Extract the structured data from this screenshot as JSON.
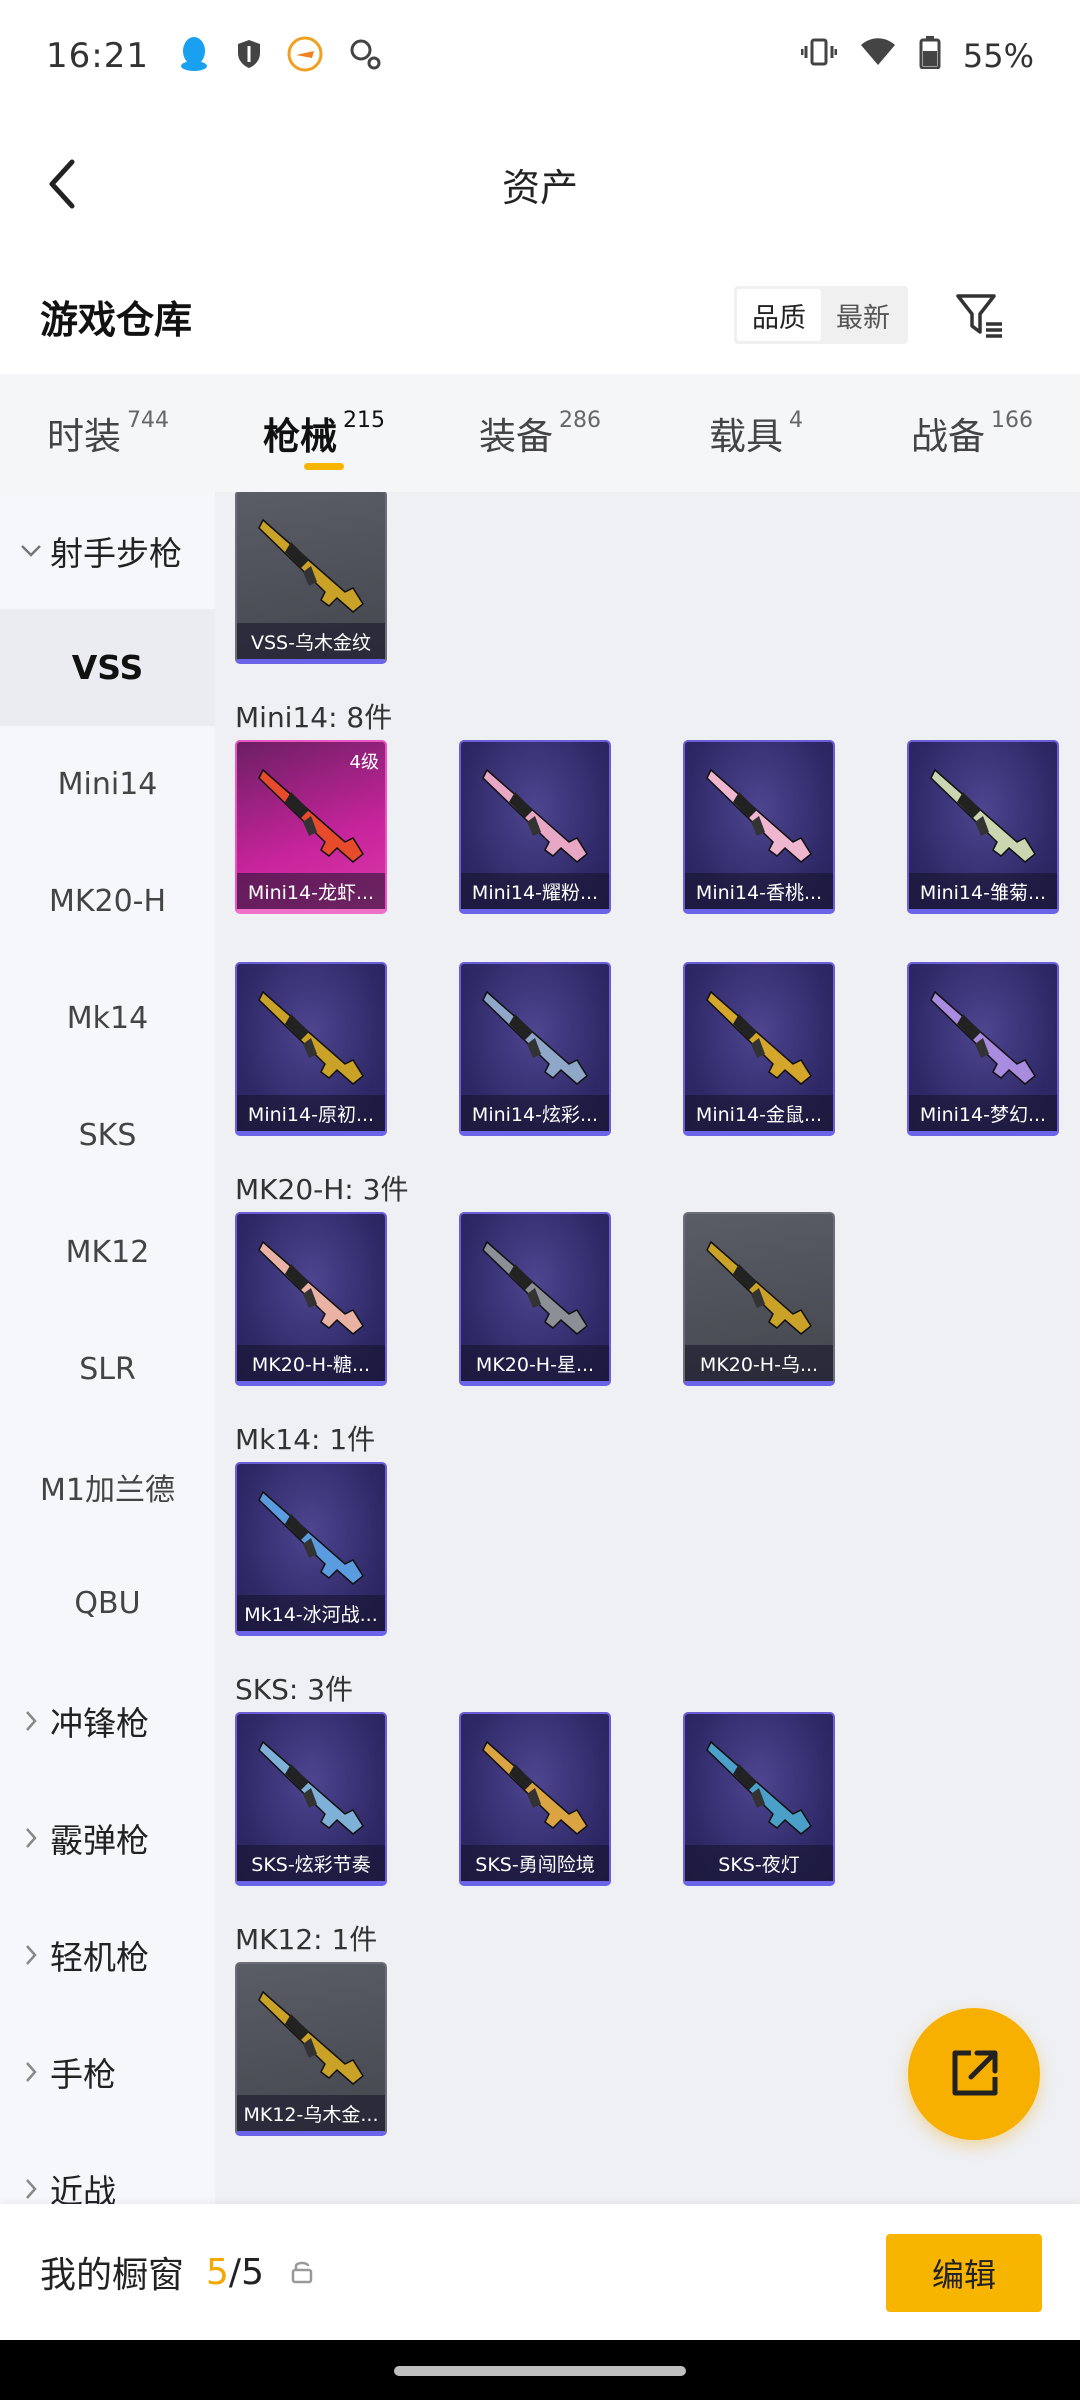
{
  "status_bar": {
    "time": "16:21",
    "battery": "55%",
    "left_icons": [
      "qq-icon",
      "shield-icon",
      "game-app-icon",
      "search-key-icon"
    ],
    "right_icons": [
      "vibrate-icon",
      "wifi-icon",
      "battery-icon"
    ]
  },
  "header": {
    "title": "资产"
  },
  "section": {
    "title": "游戏仓库",
    "sort_options": [
      "品质",
      "最新"
    ],
    "sort_active": "品质"
  },
  "tabs": [
    {
      "label": "时装",
      "count": "744"
    },
    {
      "label": "枪械",
      "count": "215"
    },
    {
      "label": "装备",
      "count": "286"
    },
    {
      "label": "载具",
      "count": "4"
    },
    {
      "label": "战备",
      "count": "166"
    }
  ],
  "active_tab": "枪械",
  "sidebar": {
    "expanded_category": "射手步枪",
    "sub_items": [
      "VSS",
      "Mini14",
      "MK20-H",
      "Mk14",
      "SKS",
      "MK12",
      "SLR",
      "M1加兰德",
      "QBU"
    ],
    "active_sub": "VSS",
    "collapsed_categories": [
      "冲锋枪",
      "霰弹枪",
      "轻机枪",
      "手枪",
      "近战"
    ]
  },
  "groups": [
    {
      "title": "",
      "cards": [
        {
          "label": "VSS-乌木金纹",
          "style": "gray",
          "gun_color": "#c9a227"
        }
      ]
    },
    {
      "title": "Mini14: 8件",
      "cards": [
        {
          "label": "Mini14-龙虾...",
          "style": "pink",
          "badge": "4级",
          "gun_color": "#e84a2c"
        },
        {
          "label": "Mini14-耀粉...",
          "style": "purple",
          "gun_color": "#e8a7c4"
        },
        {
          "label": "Mini14-香桃...",
          "style": "purple",
          "gun_color": "#f0b6cf"
        },
        {
          "label": "Mini14-雏菊...",
          "style": "purple",
          "gun_color": "#c9d6b0"
        },
        {
          "label": "Mini14-原初...",
          "style": "purple",
          "gun_color": "#c9a227"
        },
        {
          "label": "Mini14-炫彩...",
          "style": "purple",
          "gun_color": "#8fa7c9"
        },
        {
          "label": "Mini14-金鼠...",
          "style": "purple",
          "gun_color": "#d4a72c"
        },
        {
          "label": "Mini14-梦幻...",
          "style": "purple",
          "gun_color": "#a98be0"
        }
      ]
    },
    {
      "title": "MK20-H: 3件",
      "cards": [
        {
          "label": "MK20-H-糖...",
          "style": "purple",
          "gun_color": "#e9b2a5"
        },
        {
          "label": "MK20-H-星...",
          "style": "purple",
          "gun_color": "#8c8f96"
        },
        {
          "label": "MK20-H-乌...",
          "style": "gray",
          "gun_color": "#c9a227"
        }
      ]
    },
    {
      "title": "Mk14: 1件",
      "cards": [
        {
          "label": "Mk14-冰河战...",
          "style": "purple",
          "gun_color": "#5b9be0"
        }
      ]
    },
    {
      "title": "SKS: 3件",
      "cards": [
        {
          "label": "SKS-炫彩节奏",
          "style": "purple",
          "gun_color": "#7fb0d8"
        },
        {
          "label": "SKS-勇闯险境",
          "style": "purple",
          "gun_color": "#d9a441"
        },
        {
          "label": "SKS-夜灯",
          "style": "purple",
          "gun_color": "#4aa0c8"
        }
      ]
    },
    {
      "title": "MK12: 1件",
      "cards": [
        {
          "label": "MK12-乌木金...",
          "style": "gray",
          "gun_color": "#c9a227"
        }
      ]
    }
  ],
  "bottom_bar": {
    "label": "我的橱窗",
    "current": "5",
    "separator": "/",
    "total": "5",
    "edit_label": "编辑"
  },
  "colors": {
    "accent": "#f8b500",
    "card_purple": "#2e2866",
    "card_pink": "#c8249c",
    "card_border": "#6b63e8"
  }
}
